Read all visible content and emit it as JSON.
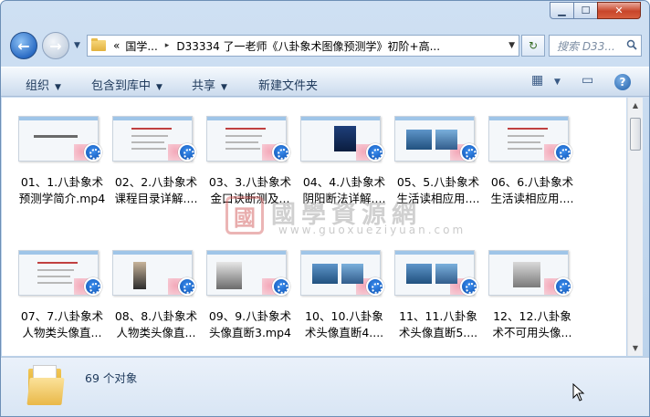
{
  "titlebar": {
    "minimize_glyph": "▁",
    "maximize_glyph": "☐",
    "close_glyph": "✕"
  },
  "navigation": {
    "back_glyph": "←",
    "forward_glyph": "→",
    "recent_glyph": "▼"
  },
  "address": {
    "overflow": "«",
    "crumbs": [
      "国学...",
      "D33334 了一老师《八卦象术图像预测学》初阶+高..."
    ],
    "separator": "▸",
    "dropdown_glyph": "▼"
  },
  "refresh_glyph": "↻",
  "search": {
    "placeholder": "搜索 D33...",
    "icon": "search-icon"
  },
  "toolbar": {
    "organize": "组织",
    "include_library": "包含到库中",
    "share": "共享",
    "new_folder": "新建文件夹",
    "caret": "▼",
    "view_glyph": "▦",
    "view_caret": "▼",
    "preview_glyph": "▭",
    "help_glyph": "?"
  },
  "files": [
    {
      "line1": "01、1.八卦象术",
      "line2": "预测学简介.mp4",
      "thumb": "title"
    },
    {
      "line1": "02、2.八卦象术",
      "line2": "课程目录详解....",
      "thumb": "list"
    },
    {
      "line1": "03、3.八卦象术",
      "line2": "金口诀断测及...",
      "thumb": "text"
    },
    {
      "line1": "04、4.八卦象术",
      "line2": "阴阳断法详解....",
      "thumb": "photo-dark"
    },
    {
      "line1": "05、5.八卦象术",
      "line2": "生活读相应用....",
      "thumb": "photo-blue"
    },
    {
      "line1": "06、6.八卦象术",
      "line2": "生活读相应用....",
      "thumb": "text"
    },
    {
      "line1": "07、7.八卦象术",
      "line2": "人物类头像直...",
      "thumb": "list"
    },
    {
      "line1": "08、8.八卦象术",
      "line2": "人物类头像直...",
      "thumb": "person"
    },
    {
      "line1": "09、9.八卦象术",
      "line2": "头像直断3.mp4",
      "thumb": "cat"
    },
    {
      "line1": "10、10.八卦象",
      "line2": "术头像直断4....",
      "thumb": "photo-blue"
    },
    {
      "line1": "11、11.八卦象",
      "line2": "术头像直断5....",
      "thumb": "photo-blue"
    },
    {
      "line1": "12、12.八卦象",
      "line2": "术不可用头像...",
      "thumb": "photo-gray"
    }
  ],
  "watermark": {
    "seal": "國",
    "text": "國學資源網",
    "url": "www.guoxueziyuan.com"
  },
  "scrollbar": {
    "up_glyph": "▲",
    "down_glyph": "▼"
  },
  "details": {
    "count_text": "69 个对象"
  },
  "colors": {
    "chrome": "#cfe0f3",
    "accent": "#2b6cc4",
    "text": "#1e395b"
  }
}
